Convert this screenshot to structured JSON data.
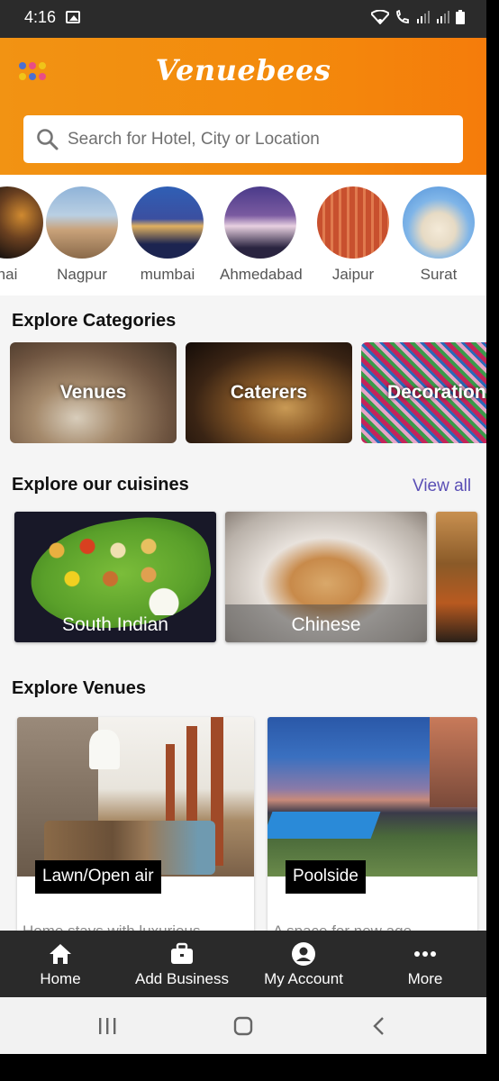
{
  "status_bar": {
    "time": "4:16"
  },
  "header": {
    "brand": "Venuebees",
    "search_placeholder": "Search for Hotel, City or Location",
    "colors": {
      "start": "#f29313",
      "end": "#f57c0b"
    }
  },
  "cities": [
    "nai",
    "Nagpur",
    "mumbai",
    "Ahmedabad",
    "Jaipur",
    "Surat"
  ],
  "categories": {
    "title": "Explore Categories",
    "items": [
      "Venues",
      "Caterers",
      "Decoration"
    ]
  },
  "cuisines": {
    "title": "Explore our cuisines",
    "view_all": "View all",
    "items": [
      "South Indian",
      "Chinese"
    ]
  },
  "venues": {
    "title": "Explore Venues",
    "items": [
      {
        "tag": "Lawn/Open air",
        "desc": "Home stays with luxurious"
      },
      {
        "tag": "Poolside",
        "desc": "A space for new age"
      }
    ]
  },
  "bottom_nav": [
    "Home",
    "Add Business",
    "My Account",
    "More"
  ]
}
